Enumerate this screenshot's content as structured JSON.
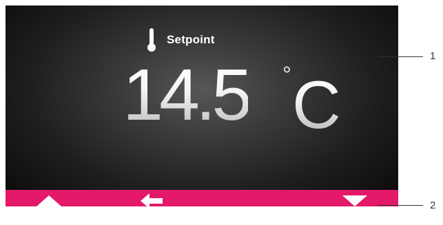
{
  "display": {
    "setpoint_label": "Setpoint",
    "temperature_value": "14.5",
    "degree_symbol": "°",
    "unit": "C",
    "icon": "thermometer-icon"
  },
  "navbar": {
    "color": "#e4196a",
    "buttons": [
      {
        "name": "up",
        "icon": "arrow-up-icon"
      },
      {
        "name": "back",
        "icon": "arrow-left-icon"
      },
      {
        "name": "down",
        "icon": "arrow-down-icon"
      }
    ]
  },
  "callouts": {
    "label_1": "1",
    "label_2": "2"
  },
  "colors": {
    "screen_background": "#1a1a1a",
    "text": "#ffffff",
    "callout": "#333333"
  }
}
